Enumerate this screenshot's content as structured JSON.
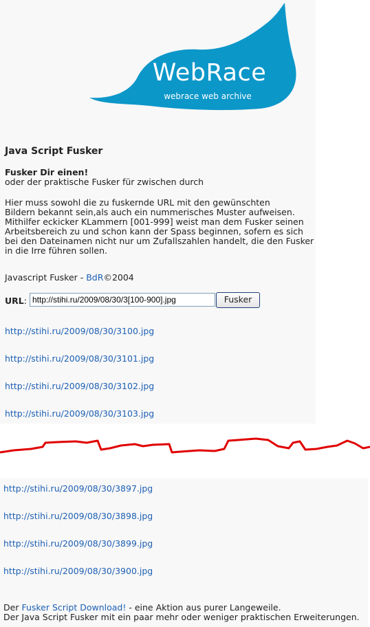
{
  "logo": {
    "title": "WebRace",
    "subtitle": "webrace web archive",
    "color": "#0c97c9"
  },
  "page": {
    "title": "Java Script Fusker",
    "intro_bold": "Fusker Dir einen!",
    "intro_line": "oder der praktische Fusker für zwischen durch",
    "description": [
      "Hier muss sowohl die zu fuskernde URL mit den gewünschten",
      "Bildern bekannt sein,als auch ein nummerisches Muster aufweisen.",
      "Mithilfer eckicker KLammern [001-999] weist man dem Fusker seinen",
      "Arbeitsbereich zu und schon kann der Spass beginnen, sofern es sich",
      "bei den Dateinamen nicht nur um Zufallszahlen handelt, die den Fusker",
      "in die Irre führen sollen."
    ],
    "credit_prefix": "Javascript Fusker - ",
    "credit_link": "BdR",
    "credit_suffix": "©2004"
  },
  "form": {
    "url_label": "URL",
    "url_colon": ":",
    "url_value": "http://stihi.ru/2009/08/30/3[100-900].jpg",
    "button_label": "Fusker"
  },
  "results_top": [
    "http://stihi.ru/2009/08/30/3100.jpg",
    "http://stihi.ru/2009/08/30/3101.jpg",
    "http://stihi.ru/2009/08/30/3102.jpg",
    "http://stihi.ru/2009/08/30/3103.jpg"
  ],
  "results_bottom": [
    "http://stihi.ru/2009/08/30/3897.jpg",
    "http://stihi.ru/2009/08/30/3898.jpg",
    "http://stihi.ru/2009/08/30/3899.jpg",
    "http://stihi.ru/2009/08/30/3900.jpg"
  ],
  "footer": {
    "line1_prefix": "Der ",
    "line1_link": "Fusker Script Download!",
    "line1_suffix": " - eine Aktion aus purer Langeweile.",
    "line2": "Der Java Script Fusker mit ein paar mehr oder weniger praktischen Erweiterungen."
  },
  "colors": {
    "link": "#1d5fb3",
    "tear_line": "#e00000",
    "panel": "#f8f8f8"
  }
}
